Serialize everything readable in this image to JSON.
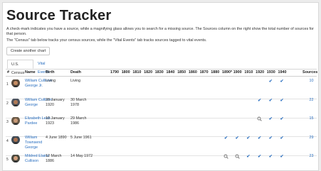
{
  "page": {
    "title": "Source Tracker",
    "desc1": "A check-mark indicates you have a source, while a magnifying glass allows you to search for a missing source. The Sources column on the right show the total number of sources for that person.",
    "desc2": "The \"Census\" tab below tracks your census sources, while the \"Vital Events\" tab tracks sources tagged to vital events.",
    "create_button": "Create another chart"
  },
  "tabs": [
    "U.S. Census",
    "Vital Events"
  ],
  "columns": {
    "num": "#",
    "name": "Name",
    "birth": "Birth",
    "death": "Death",
    "years": [
      "1790",
      "1800",
      "1810",
      "1820",
      "1830",
      "1840",
      "1850",
      "1860",
      "1870",
      "1880",
      "1890*",
      "1900",
      "1910",
      "1920",
      "1930",
      "1940"
    ],
    "sources": "Sources"
  },
  "people": [
    {
      "num": "1",
      "name": "William Cullison George Jr.",
      "birth": "Living",
      "death": "Living",
      "sources": "10",
      "marks": [
        {
          "year": "1930",
          "icon": "check"
        },
        {
          "year": "1940",
          "icon": "check"
        }
      ]
    },
    {
      "num": "2",
      "name": "William Cullison George",
      "birth": "28 January 1920",
      "death": "30 March 1978",
      "sources": "22",
      "marks": [
        {
          "year": "1920",
          "icon": "check"
        },
        {
          "year": "1930",
          "icon": "check"
        },
        {
          "year": "1940",
          "icon": "check"
        }
      ]
    },
    {
      "num": "3",
      "name": "Elizabeth Leah Pardee",
      "birth": "10 January 1923",
      "death": "29 March 1986",
      "sources": "15",
      "marks": [
        {
          "year": "1920",
          "icon": "search"
        },
        {
          "year": "1930",
          "icon": "check"
        },
        {
          "year": "1940",
          "icon": "check"
        }
      ]
    },
    {
      "num": "4",
      "name": "William Townsend George",
      "birth": "4 June 1890",
      "death": "5 June 1961",
      "sources": "29",
      "marks": [
        {
          "year": "1890*",
          "icon": "check"
        },
        {
          "year": "1900",
          "icon": "check"
        },
        {
          "year": "1910",
          "icon": "check"
        },
        {
          "year": "1920",
          "icon": "check"
        },
        {
          "year": "1930",
          "icon": "check"
        },
        {
          "year": "1940",
          "icon": "check"
        }
      ]
    },
    {
      "num": "5",
      "name": "Mildred Elaine Cullison",
      "birth": "12 March 1886",
      "death": "14 May 1972",
      "sources": "23",
      "marks": [
        {
          "year": "1890*",
          "icon": "search"
        },
        {
          "year": "1900",
          "icon": "search"
        },
        {
          "year": "1910",
          "icon": "check"
        },
        {
          "year": "1920",
          "icon": "check"
        },
        {
          "year": "1930",
          "icon": "check"
        },
        {
          "year": "1940",
          "icon": "check"
        }
      ]
    }
  ],
  "icons": {
    "check": "check-icon",
    "search": "magnifying-glass-icon",
    "avatar": "person-photo"
  },
  "colors": {
    "link": "#2a6fc0",
    "text": "#222222",
    "border": "#d6d6d6"
  }
}
